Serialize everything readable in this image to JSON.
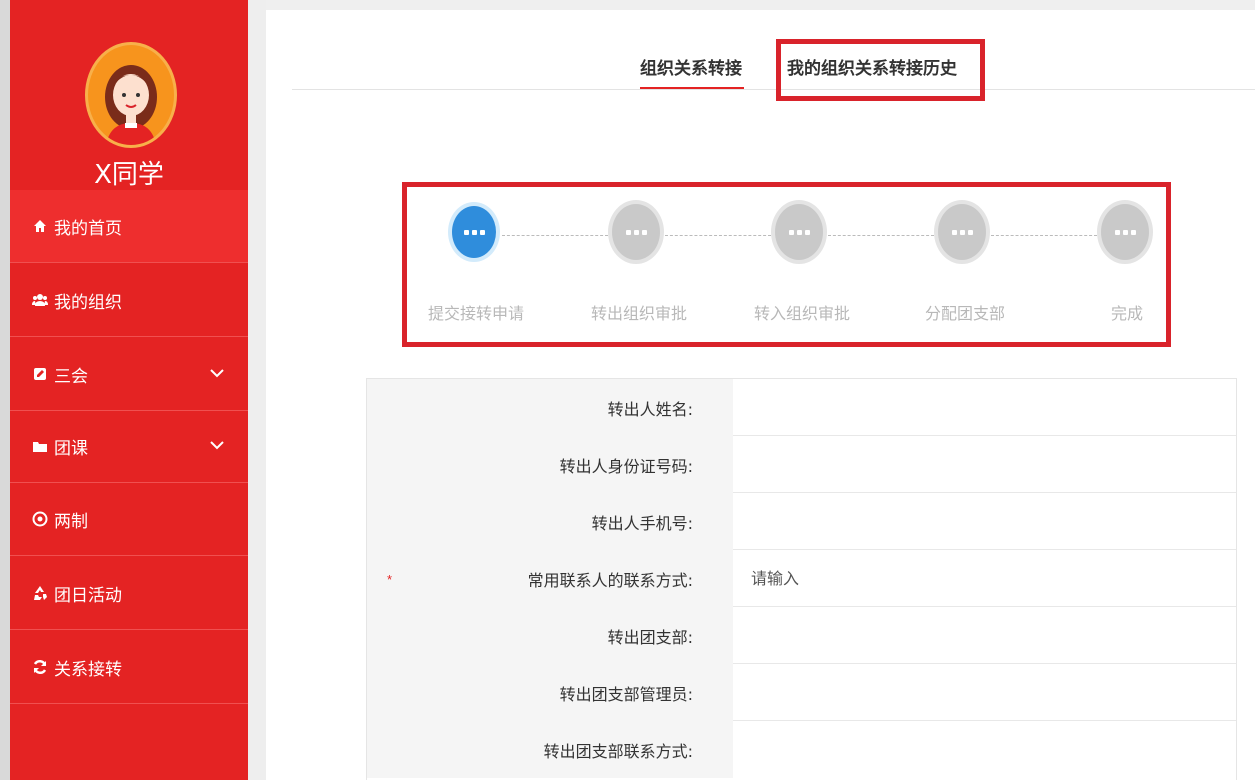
{
  "user": {
    "name": "X同学"
  },
  "sidebar": {
    "items": [
      {
        "label": "我的首页",
        "icon": "home-icon",
        "active": true
      },
      {
        "label": "我的组织",
        "icon": "users-icon"
      },
      {
        "label": "三会",
        "icon": "edit-icon",
        "expandable": true
      },
      {
        "label": "团课",
        "icon": "folder-icon",
        "expandable": true
      },
      {
        "label": "两制",
        "icon": "target-icon"
      },
      {
        "label": "团日活动",
        "icon": "recycle-icon"
      },
      {
        "label": "关系接转",
        "icon": "refresh-icon"
      }
    ]
  },
  "tabs": [
    {
      "label": "组织关系转接",
      "active": true
    },
    {
      "label": "我的组织关系转接历史"
    }
  ],
  "steps": [
    {
      "label": "提交接转申请",
      "active": true
    },
    {
      "label": "转出组织审批"
    },
    {
      "label": "转入组织审批"
    },
    {
      "label": "分配团支部"
    },
    {
      "label": "完成"
    }
  ],
  "form": {
    "fields": [
      {
        "label": "转出人姓名:",
        "value": "",
        "placeholder": ""
      },
      {
        "label": "转出人身份证号码:",
        "value": "",
        "placeholder": ""
      },
      {
        "label": "转出人手机号:",
        "value": "",
        "placeholder": ""
      },
      {
        "label": "常用联系人的联系方式:",
        "value": "",
        "placeholder": "请输入",
        "required_mark": "*"
      },
      {
        "label": "转出团支部:",
        "value": "",
        "placeholder": ""
      },
      {
        "label": "转出团支部管理员:",
        "value": "",
        "placeholder": ""
      },
      {
        "label": "转出团支部联系方式:",
        "value": "",
        "placeholder": ""
      }
    ]
  },
  "colors": {
    "brand_red": "#e42323",
    "highlight_red": "#d9232b",
    "step_active": "#2f8ddc",
    "step_inactive": "#c9c9c9"
  }
}
